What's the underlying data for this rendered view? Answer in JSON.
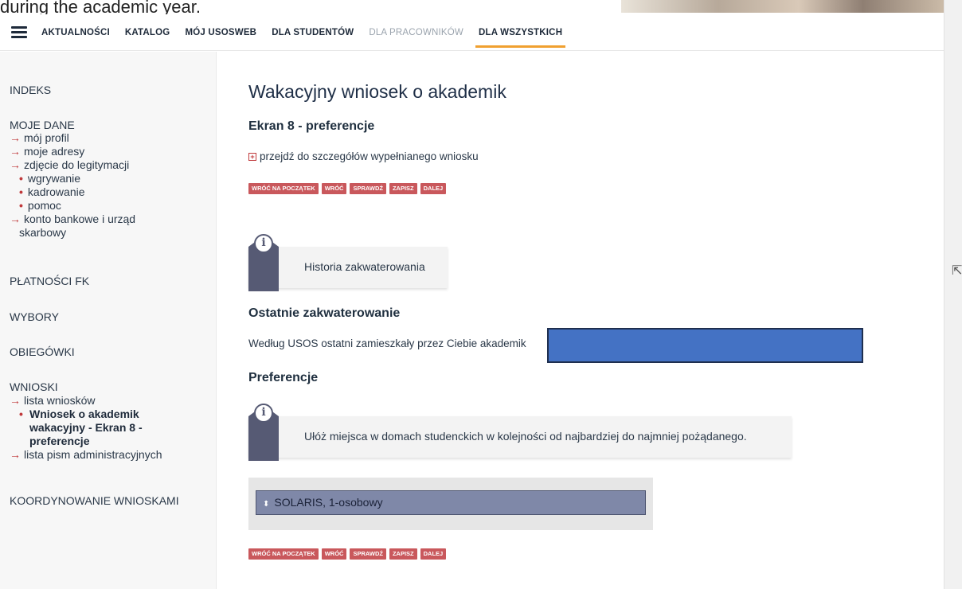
{
  "caption": "during the academic year.",
  "nav": {
    "items": [
      {
        "label": "AKTUALNOŚCI"
      },
      {
        "label": "KATALOG"
      },
      {
        "label": "MÓJ USOSWEB"
      },
      {
        "label": "DLA STUDENTÓW"
      },
      {
        "label": "DLA PRACOWNIKÓW"
      },
      {
        "label": "DLA WSZYSTKICH"
      }
    ],
    "active_index": 5,
    "accent": "#f0a030"
  },
  "sidebar": {
    "indeks": "INDEKS",
    "moje_dane": "MOJE DANE",
    "moj_profil": "mój profil",
    "moje_adresy": "moje adresy",
    "zdjecie": "zdjęcie do legitymacji",
    "wgrywanie": "wgrywanie",
    "kadrowanie": "kadrowanie",
    "pomoc": "pomoc",
    "konto_1": "konto bankowe i urząd",
    "konto_2": "skarbowy",
    "platnosci": "PŁATNOŚCI FK",
    "wybory": "WYBORY",
    "obiegowki": "OBIEGÓWKI",
    "wnioski": "WNIOSKI",
    "lista_wnioskow": "lista wniosków",
    "current_1": "Wniosek o akademik",
    "current_2": "wakacyjny - Ekran 8 -",
    "current_3": "preferencje",
    "lista_pism": "lista pism administracyjnych",
    "koordynowanie": "KOORDYNOWANIE WNIOSKAMI"
  },
  "main": {
    "title": "Wakacyjny wniosek o akademik",
    "screen_heading": "Ekran 8 - preferencje",
    "details_link": "przejdź do szczegółów wypełnianego wniosku",
    "buttons": {
      "start": "WRÓĆ NA POCZĄTEK",
      "back": "WRÓĆ",
      "check": "SPRAWDŹ",
      "save": "ZAPISZ",
      "next": "DALEJ"
    },
    "info_history": "Historia zakwaterowania",
    "last_heading": "Ostatnie zakwaterowanie",
    "last_text": "Według USOS ostatni zamieszkały przez Ciebie akademik",
    "pref_heading": "Preferencje",
    "pref_info": "Ułóż miejsca w domach studenckich w kolejności od najbardziej do najmniej pożądanego.",
    "pref_items": [
      {
        "label": "SOLARIS, 1-osobowy"
      }
    ],
    "redaction_color": "#4472c4"
  }
}
